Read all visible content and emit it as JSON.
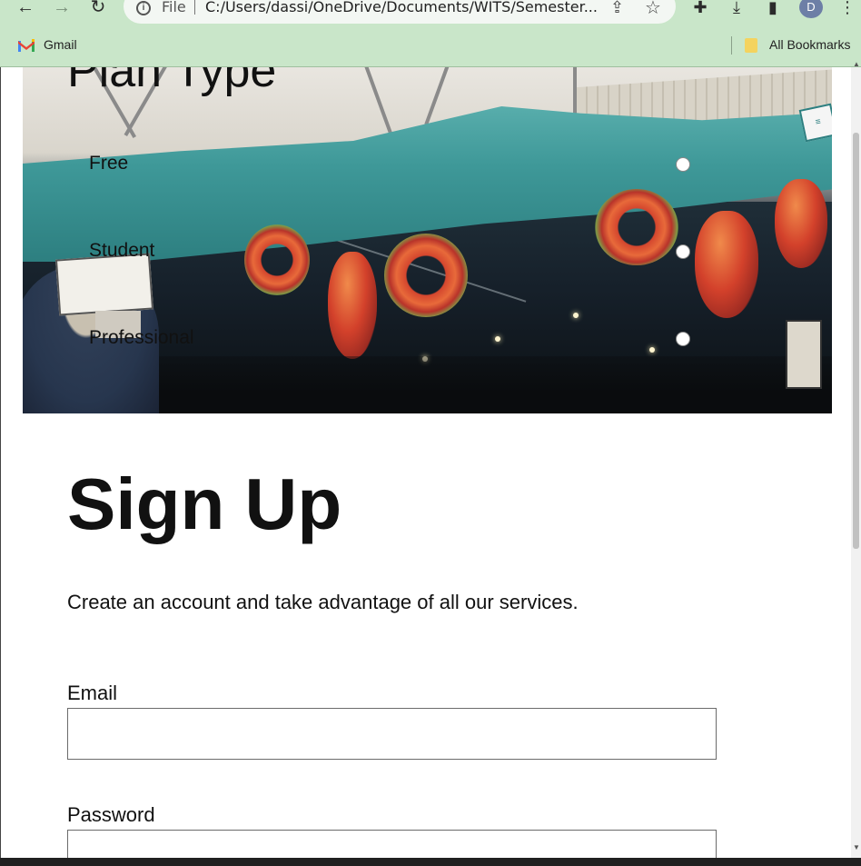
{
  "browser": {
    "file_label": "File",
    "url": "C:/Users/dassi/OneDrive/Documents/WITS/Semester...",
    "profile_initial": "D",
    "bookmarks": {
      "gmail": "Gmail",
      "all_bookmarks": "All Bookmarks"
    }
  },
  "plan": {
    "title": "Plan Type",
    "options": [
      "Free",
      "Student",
      "Professional"
    ]
  },
  "signup": {
    "title": "Sign Up",
    "subtitle": "Create an account and take advantage of all our services.",
    "email_label": "Email",
    "email_value": "",
    "password_label": "Password",
    "password_value": ""
  },
  "colors": {
    "chrome_bg": "#c9e6c9",
    "canopy": "#3e9898",
    "text": "#111111"
  }
}
